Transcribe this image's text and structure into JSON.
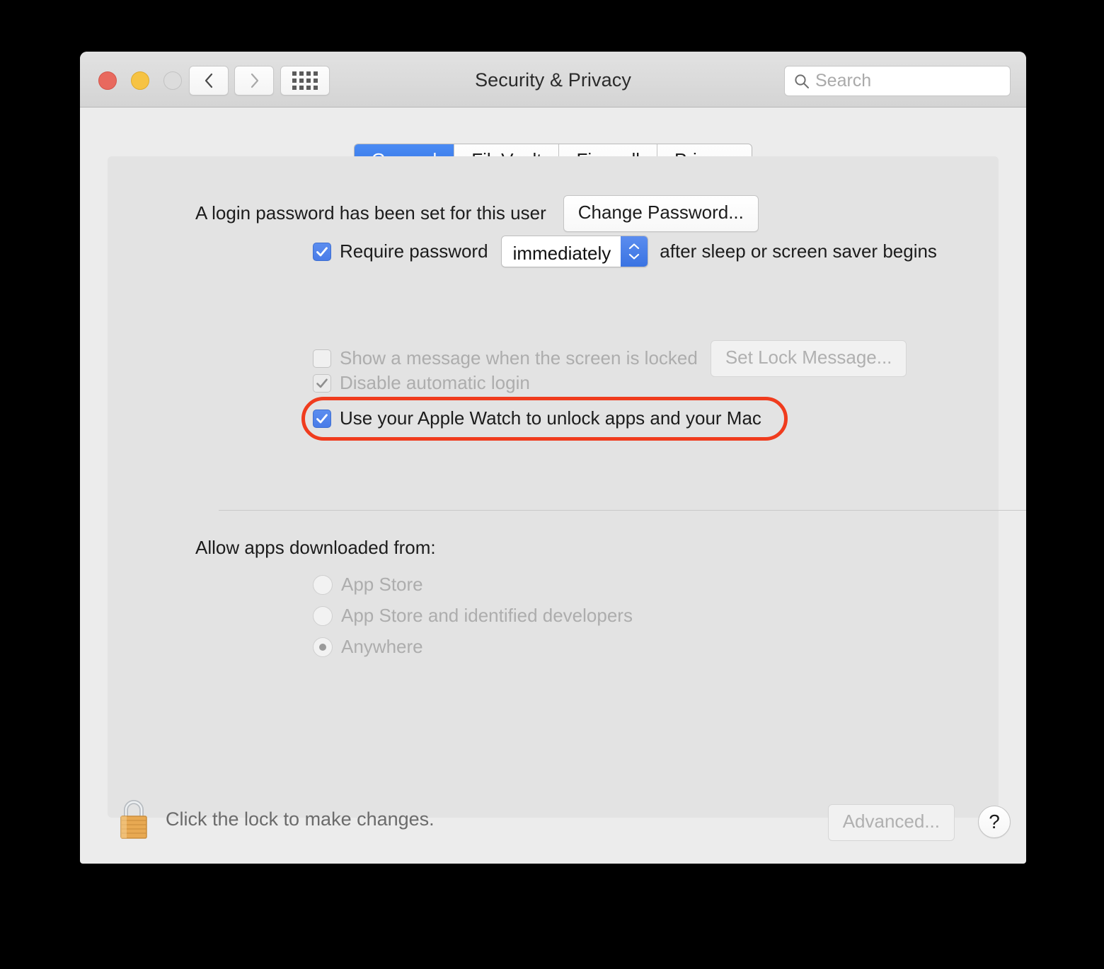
{
  "window": {
    "title": "Security & Privacy",
    "traffic_lights": [
      {
        "name": "close",
        "color": "#e8695e"
      },
      {
        "name": "minimize",
        "color": "#f6c344"
      },
      {
        "name": "zoom",
        "color": "#dcdcdc"
      }
    ],
    "nav": {
      "back_icon": "chevron-left-icon",
      "forward_icon": "chevron-right-icon",
      "grid_icon": "show-all-grid-icon"
    },
    "search": {
      "placeholder": "Search",
      "value": "",
      "icon": "search-icon"
    }
  },
  "tabs": [
    {
      "label": "General",
      "active": true
    },
    {
      "label": "FileVault",
      "active": false
    },
    {
      "label": "Firewall",
      "active": false
    },
    {
      "label": "Privacy",
      "active": false
    }
  ],
  "general": {
    "login_password_status": "A login password has been set for this user",
    "change_password_button": "Change Password...",
    "require_password": {
      "label_before": "Require password",
      "interval_value": "immediately",
      "label_after": "after sleep or screen saver begins",
      "checked": true
    },
    "show_message": {
      "label": "Show a message when the screen is locked",
      "button": "Set Lock Message...",
      "checked": false,
      "enabled": false
    },
    "disable_auto_login": {
      "label": "Disable automatic login",
      "checked": true,
      "enabled": false
    },
    "apple_watch": {
      "label": "Use your Apple Watch to unlock apps and your Mac",
      "checked": true,
      "highlighted": true,
      "highlight_color": "#f03c1e"
    },
    "allow_apps_heading": "Allow apps downloaded from:",
    "allow_apps_options": [
      {
        "label": "App Store",
        "selected": false
      },
      {
        "label": "App Store and identified developers",
        "selected": false
      },
      {
        "label": "Anywhere",
        "selected": true
      }
    ]
  },
  "footer": {
    "lock_icon": "lock-closed-icon",
    "lock_text": "Click the lock to make changes.",
    "advanced_button": "Advanced...",
    "help_button": "?"
  },
  "colors": {
    "accent_blue": "#4a7ce8",
    "tab_active_blue": "#3a78e8",
    "highlight_red": "#f03c1e",
    "window_bg": "#ececec",
    "panel_bg": "#e3e3e3"
  }
}
